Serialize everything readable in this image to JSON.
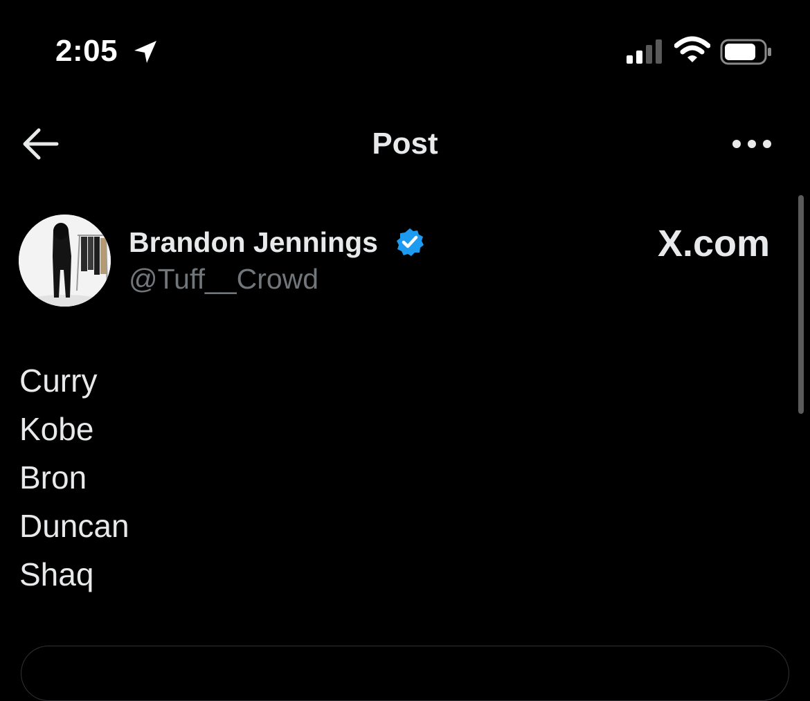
{
  "status_bar": {
    "time": "2:05",
    "icons": [
      "location-arrow-icon",
      "signal-icon",
      "wifi-icon",
      "battery-icon"
    ]
  },
  "header": {
    "title": "Post",
    "back_icon": "arrow-left-icon",
    "more_icon": "more-horizontal-icon"
  },
  "author": {
    "name": "Brandon Jennings",
    "handle": "@Tuff__Crowd",
    "verified": true,
    "verified_color": "#1d9bf0"
  },
  "watermark": "X.com",
  "post": {
    "lines": [
      "Curry",
      "Kobe",
      "Bron",
      "Duncan",
      "Shaq"
    ]
  },
  "colors": {
    "background": "#000000",
    "text_primary": "#e7e9ea",
    "text_secondary": "#71767b",
    "accent": "#1d9bf0"
  }
}
